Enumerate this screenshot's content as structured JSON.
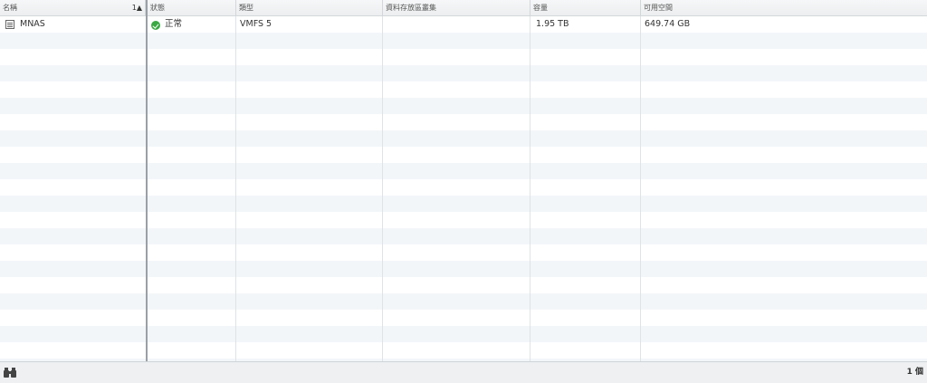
{
  "grid": {
    "columns": [
      {
        "key": "name",
        "label": "名稱",
        "sort": "1▲"
      },
      {
        "key": "status",
        "label": "狀態"
      },
      {
        "key": "type",
        "label": "類型"
      },
      {
        "key": "cluster",
        "label": "資料存放區叢集"
      },
      {
        "key": "capacity",
        "label": "容量"
      },
      {
        "key": "free",
        "label": "可用空間"
      }
    ],
    "rows": [
      {
        "name": "MNAS",
        "status": "正常",
        "type": "VMFS 5",
        "cluster": "",
        "capacity": "1.95  TB",
        "free": "649.74  GB"
      }
    ]
  },
  "icons": {
    "datastore": "datastore-icon",
    "status_ok": "check-circle-icon",
    "filter": "binoculars-icon"
  },
  "colors": {
    "status_ok": "#3aa843",
    "row_stripe": "#f3f6f9",
    "header_bg": "#eceeef"
  },
  "footer": {
    "count": "1 個"
  }
}
